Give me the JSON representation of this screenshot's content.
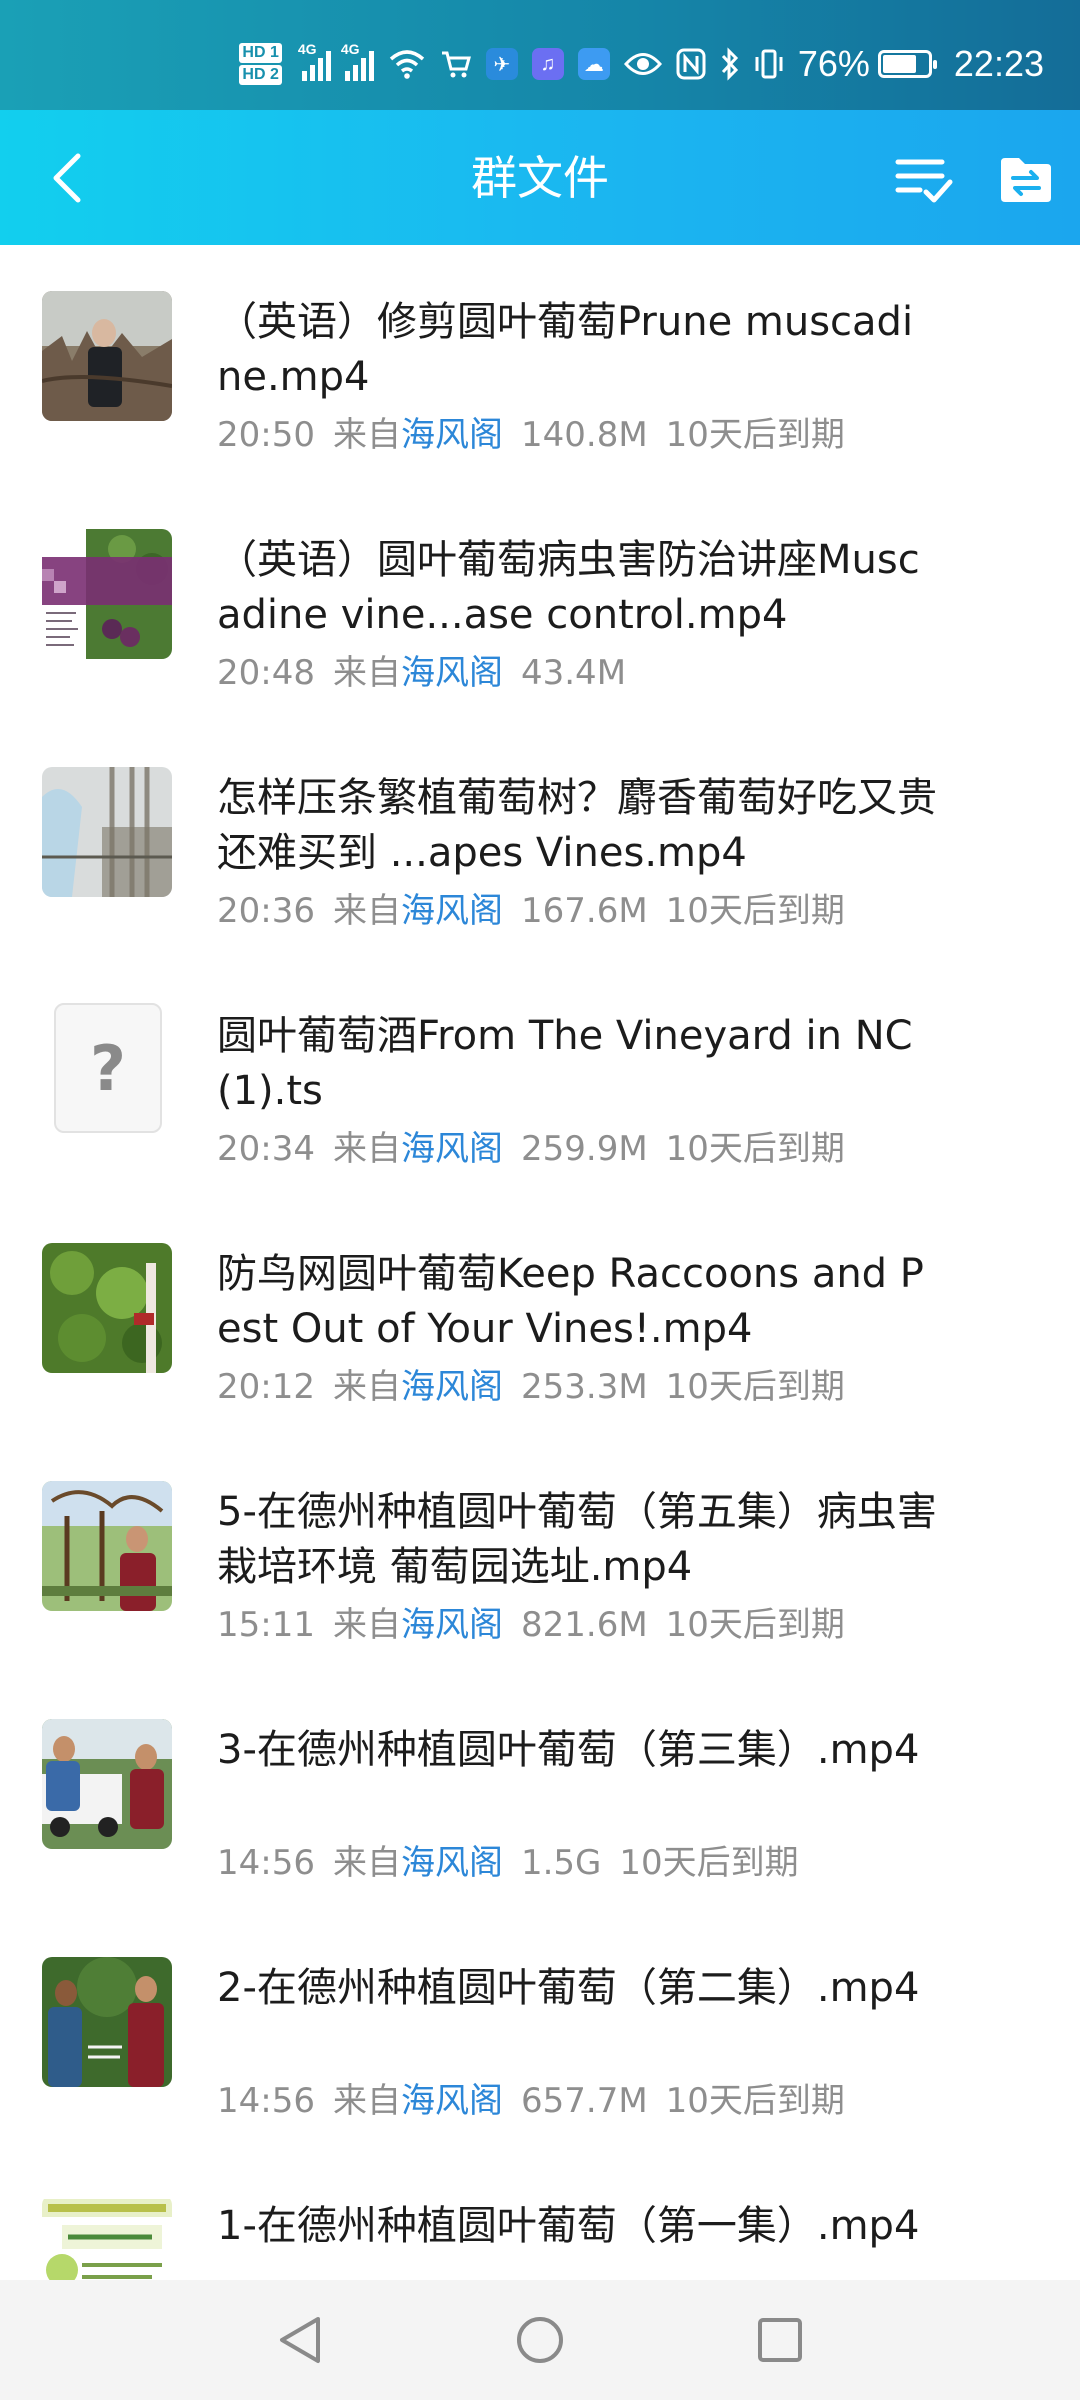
{
  "status": {
    "sim1": "HD 1",
    "sim2": "HD 2",
    "net1": "4G",
    "net2": "4G",
    "battery": "76%",
    "battery_fraction": 0.76,
    "time": "22:23"
  },
  "header": {
    "title": "群文件"
  },
  "files": [
    {
      "name": "（英语）修剪圆叶葡萄Prune muscadine.mp4",
      "time": "20:50",
      "from": "来自",
      "sender": "海风阁",
      "size": "140.8M",
      "expiry": "10天后到期",
      "thumb": "video"
    },
    {
      "name": "（英语）圆叶葡萄病虫害防治讲座Muscadine vine...ase control.mp4",
      "time": "20:48",
      "from": "来自",
      "sender": "海风阁",
      "size": "43.4M",
      "expiry": "",
      "thumb": "slide",
      "thumb_text": "Disease Control in Muscadine Vineyards"
    },
    {
      "name": "怎样压条繁植葡萄树？麝香葡萄好吃又贵还难买到 ...apes Vines.mp4",
      "time": "20:36",
      "from": "来自",
      "sender": "海风阁",
      "size": "167.6M",
      "expiry": "10天后到期",
      "thumb": "video"
    },
    {
      "name": "圆叶葡萄酒From The Vineyard in NC (1).ts",
      "time": "20:34",
      "from": "来自",
      "sender": "海风阁",
      "size": "259.9M",
      "expiry": "10天后到期",
      "thumb": "unknown",
      "thumb_text": "?"
    },
    {
      "name": "防鸟网圆叶葡萄Keep Raccoons and Pest Out of Your Vines!.mp4",
      "time": "20:12",
      "from": "来自",
      "sender": "海风阁",
      "size": "253.3M",
      "expiry": "10天后到期",
      "thumb": "video"
    },
    {
      "name": "5-在德州种植圆叶葡萄（第五集）病虫害 栽培环境 葡萄园选址.mp4",
      "time": "15:11",
      "from": "来自",
      "sender": "海风阁",
      "size": "821.6M",
      "expiry": "10天后到期",
      "thumb": "video"
    },
    {
      "name": "3-在德州种植圆叶葡萄（第三集）.mp4",
      "time": "14:56",
      "from": "来自",
      "sender": "海风阁",
      "size": "1.5G",
      "expiry": "10天后到期",
      "thumb": "video"
    },
    {
      "name": "2-在德州种植圆叶葡萄（第二集）.mp4",
      "time": "14:56",
      "from": "来自",
      "sender": "海风阁",
      "size": "657.7M",
      "expiry": "10天后到期",
      "thumb": "video"
    },
    {
      "name": "1-在德州种植圆叶葡萄（第一集）.mp4",
      "time": "",
      "from": "",
      "sender": "",
      "size": "",
      "expiry": "",
      "thumb": "video"
    }
  ],
  "colors": {
    "statusbar": "#1585a8",
    "appbar": "#1bb6f0",
    "sender_link": "#2c87d8",
    "meta_text": "#8e8e8e"
  },
  "icons": {
    "back": "back-arrow-icon",
    "multiselect": "multi-select-icon",
    "folder": "folder-transfer-icon",
    "nav_back": "nav-back-icon",
    "nav_home": "nav-home-icon",
    "nav_recents": "nav-recents-icon"
  }
}
